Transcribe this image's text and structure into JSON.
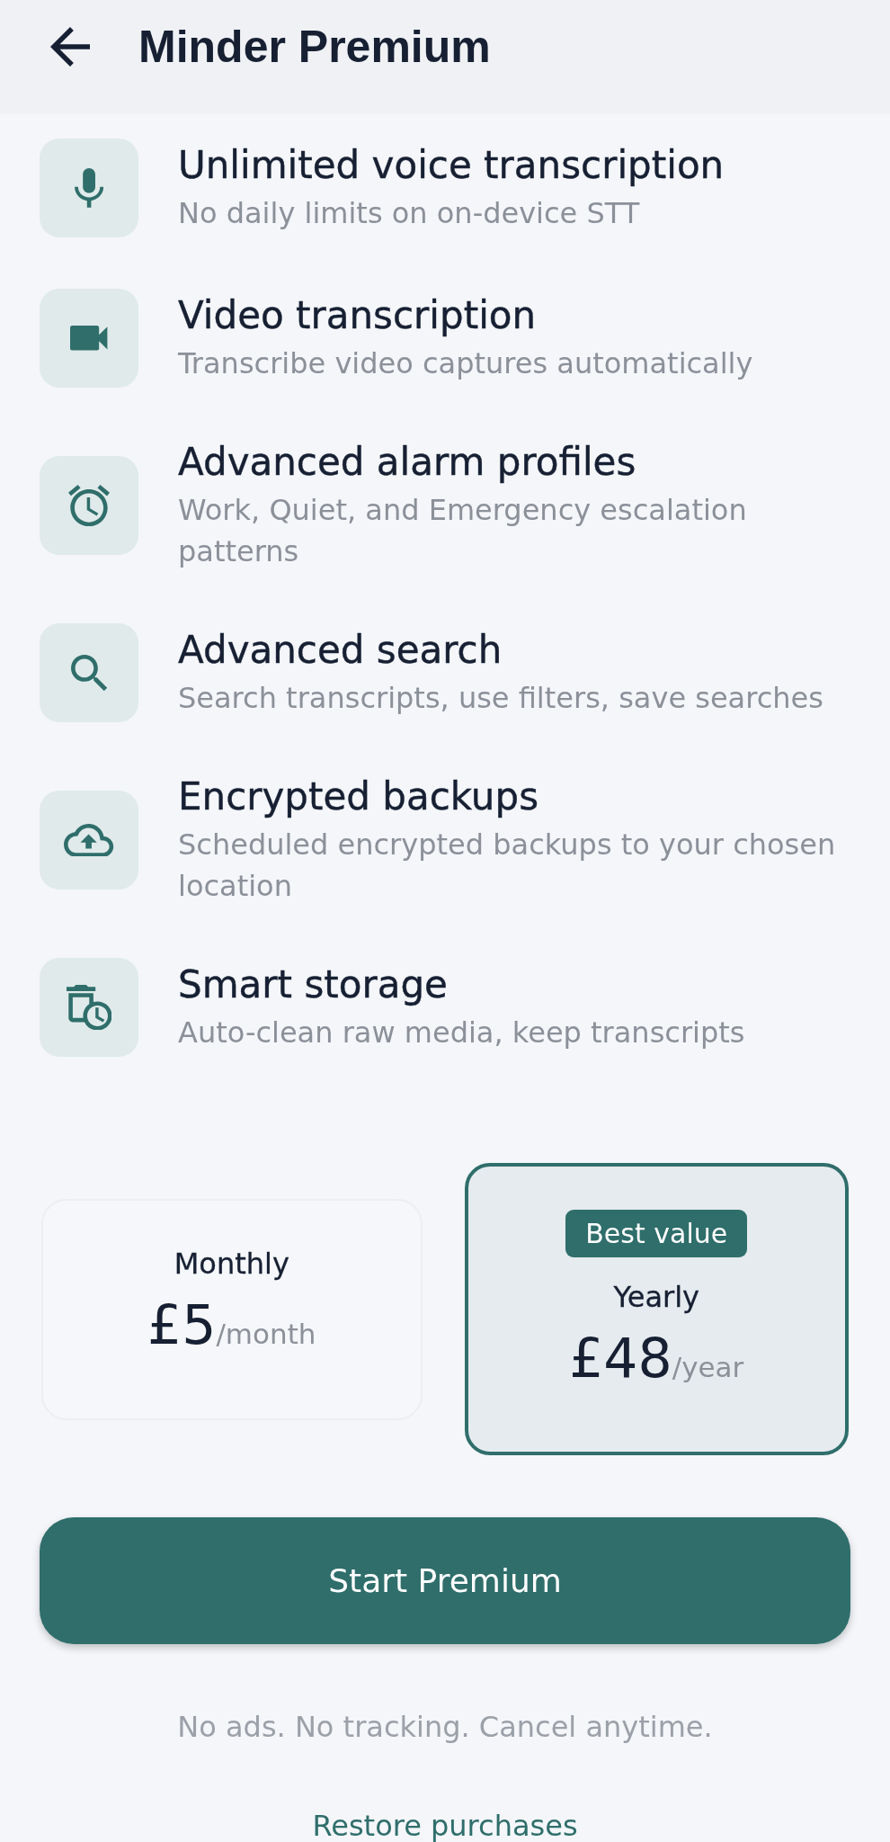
{
  "header": {
    "title": "Minder Premium"
  },
  "features": [
    {
      "title": "Unlimited voice transcription",
      "description": "No daily limits on on-device STT"
    },
    {
      "title": "Video transcription",
      "description": "Transcribe video captures automatically"
    },
    {
      "title": "Advanced alarm profiles",
      "description": "Work, Quiet, and Emergency escalation patterns"
    },
    {
      "title": "Advanced search",
      "description": "Search transcripts, use filters, save searches"
    },
    {
      "title": "Encrypted backups",
      "description": "Scheduled encrypted backups to your chosen location"
    },
    {
      "title": "Smart storage",
      "description": "Auto-clean raw media, keep transcripts"
    }
  ],
  "plans": [
    {
      "name": "Monthly",
      "price": "£5",
      "period": "/month",
      "selected": false
    },
    {
      "badge": "Best value",
      "name": "Yearly",
      "price": "£48",
      "period": "/year",
      "selected": true
    }
  ],
  "primary_button": {
    "label": "Start Premium"
  },
  "note": "No ads. No tracking. Cancel anytime.",
  "restore_link": {
    "label": "Restore purchases"
  }
}
